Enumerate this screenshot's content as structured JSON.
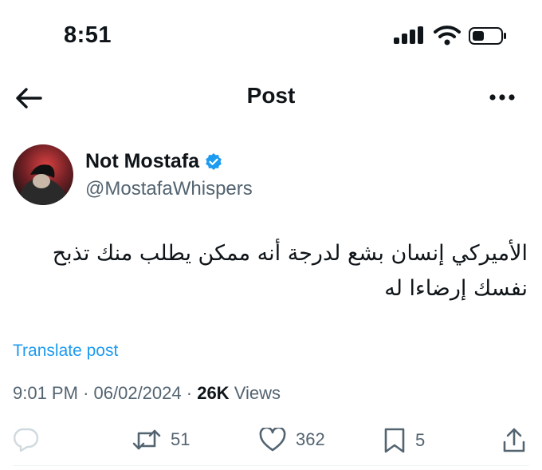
{
  "status_bar": {
    "time": "8:51"
  },
  "header": {
    "title": "Post"
  },
  "author": {
    "name": "Not Mostafa",
    "handle": "@MostafaWhispers",
    "verified": true
  },
  "tweet": {
    "text_line1": "الأميركي إنسان بشع لدرجة أنه ممكن يطلب منك تذبح",
    "text_line2": "نفسك إرضاءا له"
  },
  "translate_label": "Translate post",
  "meta": {
    "time": "9:01 PM",
    "separator": "·",
    "date": "06/02/2024",
    "views_count": "26K",
    "views_label": "Views"
  },
  "actions": {
    "replies": "",
    "reposts": "51",
    "likes": "362",
    "bookmarks": "5"
  },
  "colors": {
    "accent": "#1d9bf0",
    "secondary_text": "#536471",
    "primary_text": "#0f1419"
  },
  "icons": [
    "back-arrow-icon",
    "more-icon",
    "verified-badge-icon",
    "reply-icon",
    "repost-icon",
    "like-icon",
    "bookmark-icon",
    "share-icon",
    "signal-icon",
    "wifi-icon",
    "battery-icon"
  ]
}
